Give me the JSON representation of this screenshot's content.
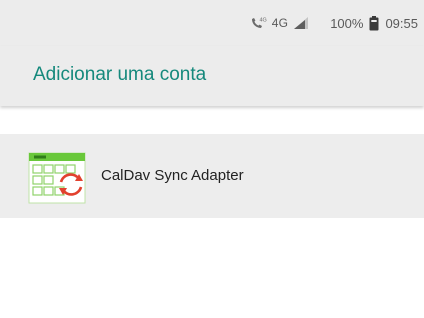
{
  "status_bar": {
    "call_icon": "wifi-calling-icon",
    "call_icon_label": "4G",
    "network_type": "4G",
    "signal_icon": "signal-icon",
    "battery_percent": "100%",
    "battery_icon": "battery-full-icon",
    "time": "09:55"
  },
  "app_bar": {
    "title": "Adicionar uma conta"
  },
  "accounts": [
    {
      "label": "CalDav Sync Adapter",
      "icon": "calendar-sync-icon"
    }
  ],
  "colors": {
    "accent": "#15897c",
    "app_bar_bg": "#ececec",
    "row_bg": "#ededed",
    "text_primary": "#222222",
    "icon_green": "#69c83a",
    "icon_red": "#e2412e"
  }
}
